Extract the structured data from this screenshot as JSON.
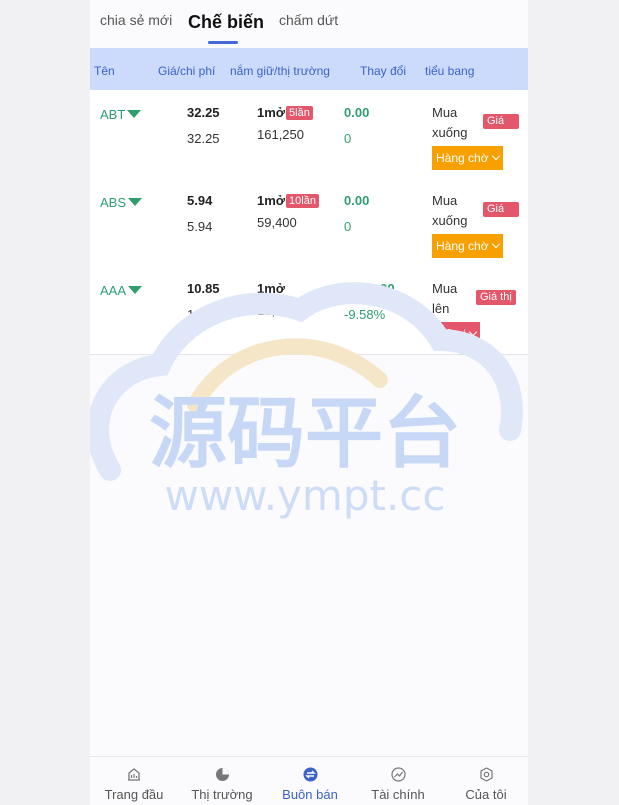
{
  "tabs": [
    {
      "label": "chia sẻ mới"
    },
    {
      "label": "Chế biến"
    },
    {
      "label": "chấm dứt"
    }
  ],
  "header": {
    "name": "Tên",
    "price_cost": "Giá/chi phí",
    "holding_market": "nắm giữ/thị trường",
    "change": "Thay đổi",
    "state": "tiểu bang"
  },
  "rows": [
    {
      "symbol": "ABT",
      "price": "32.25",
      "cost": "32.25",
      "lots": "1mở",
      "times": "5lần",
      "market": "161,250",
      "change": "0.00",
      "change_pct": "0",
      "status_line1": "Mua",
      "status_line2": "xuống",
      "tag": "Giá",
      "action": "Hàng chờ",
      "action_color": "#f6a100"
    },
    {
      "symbol": "ABS",
      "price": "5.94",
      "cost": "5.94",
      "lots": "1mở",
      "times": "10lần",
      "market": "59,400",
      "change": "0.00",
      "change_pct": "0",
      "status_line1": "Mua",
      "status_line2": "xuống",
      "tag": "Giá",
      "action": "Hàng chờ",
      "action_color": "#f6a100"
    },
    {
      "symbol": "AAA",
      "price": "10.85",
      "cost": "12.00",
      "lots": "1mở",
      "times": "",
      "market": "10,850",
      "change": "-1150.00",
      "change_pct": "-9.58%",
      "status_line1": "Mua",
      "status_line2": "lên",
      "tag": "Giá thị",
      "action": "Mở vị",
      "action_color": "#e4566a"
    }
  ],
  "watermark": {
    "title": "源码平台",
    "url": "www.ympt.cc"
  },
  "nav": [
    {
      "label": "Trang đầu",
      "icon": "home-chart-icon"
    },
    {
      "label": "Thị trường",
      "icon": "pie-chart-icon"
    },
    {
      "label": "Buôn bán",
      "icon": "exchange-icon"
    },
    {
      "label": "Tài chính",
      "icon": "trend-icon"
    },
    {
      "label": "Của tôi",
      "icon": "user-gear-icon"
    }
  ],
  "colors": {
    "accent": "#4468d8",
    "up": "#2f9e6e",
    "red": "#e4566a",
    "orange": "#f6a100",
    "header_bg": "#ccdbfb"
  }
}
